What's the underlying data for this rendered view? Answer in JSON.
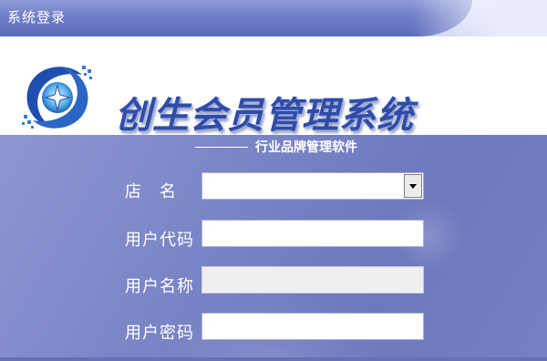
{
  "window": {
    "title": "系统登录"
  },
  "header": {
    "logo_icon": "sparkle-swirl-logo-icon",
    "brand_name": "创生会员管理系统",
    "slogan": "行业品牌管理软件"
  },
  "form": {
    "store_label": "店　名",
    "store_value": "",
    "user_code_label": "用户代码",
    "user_code_value": "",
    "user_name_label": "用户名称",
    "user_name_value": "",
    "password_label": "用户密码",
    "password_value": ""
  },
  "colors": {
    "title_bar": "#6f7ec7",
    "panel": "#7b86c7",
    "brand_text": "#2f4da8"
  }
}
